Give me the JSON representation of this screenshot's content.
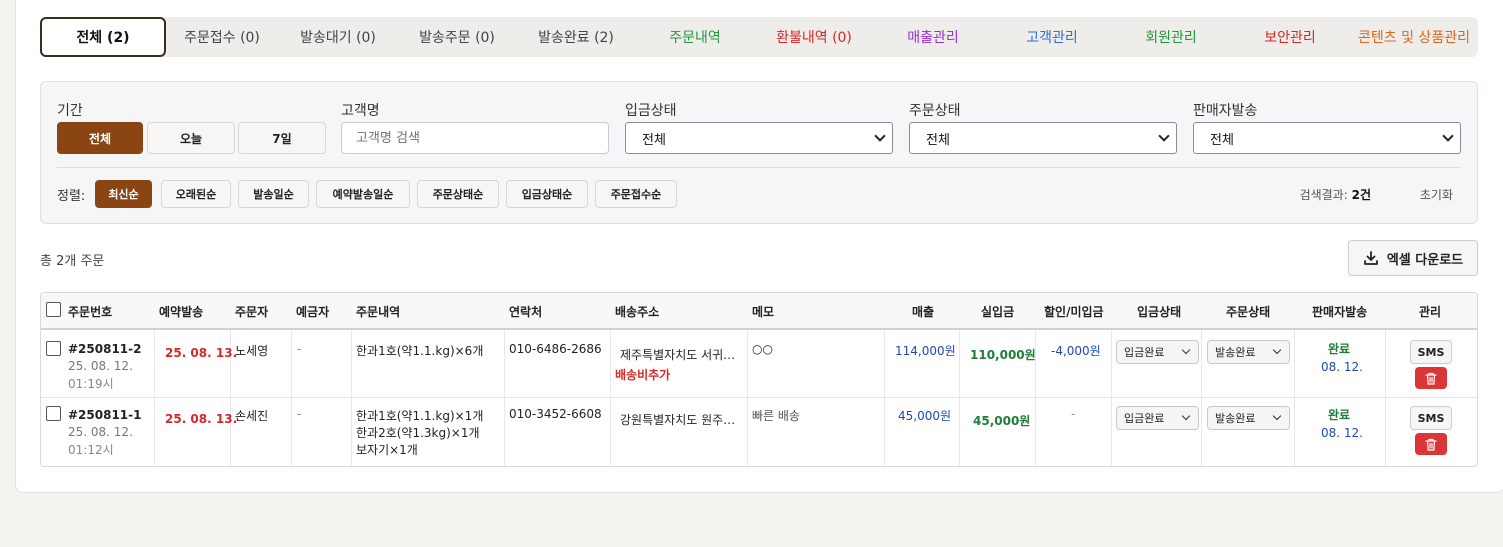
{
  "tabs": [
    {
      "label": "전체 (2)",
      "color": "#111111"
    },
    {
      "label": "주문접수 (0)",
      "color": "#444444"
    },
    {
      "label": "발송대기 (0)",
      "color": "#444444"
    },
    {
      "label": "발송주문 (0)",
      "color": "#444444"
    },
    {
      "label": "발송완료 (2)",
      "color": "#444444"
    },
    {
      "label": "주문내역",
      "color": "#22963b"
    },
    {
      "label": "환불내역 (0)",
      "color": "#d62828"
    },
    {
      "label": "매출관리",
      "color": "#9b30d9"
    },
    {
      "label": "고객관리",
      "color": "#2e6fd8"
    },
    {
      "label": "회원관리",
      "color": "#22963b"
    },
    {
      "label": "보안관리",
      "color": "#d62828"
    },
    {
      "label": "콘텐츠 및 상품관리",
      "color": "#e0661a"
    }
  ],
  "filter": {
    "period_label": "기간",
    "period_options": [
      "전체",
      "오늘",
      "7일"
    ],
    "customer_label": "고객명",
    "customer_placeholder": "고객명 검색",
    "deposit_label": "입금상태",
    "deposit_value": "전체",
    "order_status_label": "주문상태",
    "order_status_value": "전체",
    "seller_label": "판매자발송",
    "seller_value": "전체",
    "sort_label": "정렬:",
    "sort_options": [
      "최신순",
      "오래된순",
      "발송일순",
      "예약발송일순",
      "주문상태순",
      "입금상태순",
      "주문접수순"
    ],
    "result_prefix": "검색결과:",
    "result_count": "2건",
    "reset_label": "초기화"
  },
  "summary": {
    "total_text": "총 2개 주문",
    "excel_label": "엑셀 다운로드"
  },
  "table": {
    "headers": [
      "주문번호",
      "예약발송",
      "주문자",
      "예금자",
      "주문내역",
      "연락처",
      "배송주소",
      "메모",
      "매출",
      "실입금",
      "할인/미입금",
      "입금상태",
      "주문상태",
      "판매자발송",
      "관리"
    ],
    "rows": [
      {
        "order_no": "#250811-2",
        "order_date": "25. 08. 12.",
        "order_time": "01:19시",
        "reserve": "25. 08. 13.",
        "orderer": "노세영",
        "depositor": "-",
        "items": [
          "한과1호(약1.1.kg)×6개"
        ],
        "phone": "010-6486-2686",
        "address": "제주특별자치도 서귀…",
        "address_note": "배송비추가",
        "memo": "○○",
        "sales": "114,000원",
        "paid": "110,000원",
        "discount": "-4,000원",
        "deposit_status": "입금완료",
        "order_status": "발송완료",
        "seller_status": "완료",
        "seller_date": "08. 12.",
        "sms_label": "SMS"
      },
      {
        "order_no": "#250811-1",
        "order_date": "25. 08. 12.",
        "order_time": "01:12시",
        "reserve": "25. 08. 13.",
        "orderer": "손세진",
        "depositor": "-",
        "items": [
          "한과1호(약1.1.kg)×1개",
          "한과2호(약1.3kg)×1개",
          "보자기×1개"
        ],
        "phone": "010-3452-6608",
        "address": "강원특별자치도 원주…",
        "address_note": "",
        "memo": "빠른 배송",
        "sales": "45,000원",
        "paid": "45,000원",
        "discount": "-",
        "deposit_status": "입금완료",
        "order_status": "발송완료",
        "seller_status": "완료",
        "seller_date": "08. 12.",
        "sms_label": "SMS"
      }
    ]
  },
  "colors": {
    "accent": "#8b4513",
    "reserve_red": "#d62828",
    "sales_blue": "#2147b8",
    "paid_green": "#1e7d36",
    "delete_red": "#dc3535"
  }
}
